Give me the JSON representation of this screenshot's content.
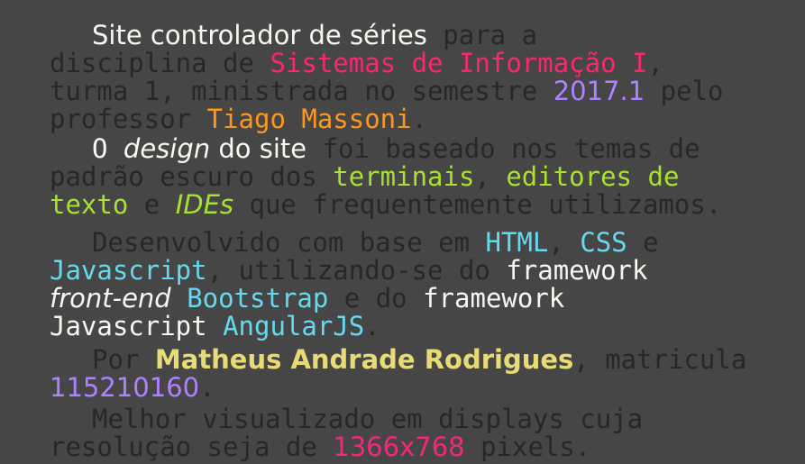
{
  "colors": {
    "background": "#464646",
    "dim_text": "#272727",
    "white": "#f8f8f2",
    "pink": "#f92672",
    "purple": "#ae81ff",
    "orange": "#fd971f",
    "green": "#a6e22e",
    "cyan": "#66d9ef",
    "yellow": "#e6db74"
  },
  "p1": {
    "site_title": "Site controlador de séries",
    "t1": " para a",
    "t2": "disciplina de ",
    "discipline": "Sistemas de Informação I",
    "t3": ",",
    "t4": "turma 1, ministrada no semestre ",
    "semester": "2017.1",
    "t5": " pelo",
    "t6": "professor ",
    "professor": "Tiago Massoni",
    "t7": "."
  },
  "p2": {
    "t1": "O ",
    "design": "design",
    "t2": " do site",
    "t3": " foi baseado nos temas de",
    "t4": "padrão escuro dos ",
    "terminals": "terminais",
    "t5": ", ",
    "editors": "editores de",
    "editors2": "texto",
    "t6": " e ",
    "ides": "IDEs",
    "t7": " que frequentemente utilizamos."
  },
  "p3": {
    "t1": "Desenvolvido com base em ",
    "html": "HTML",
    "t2": ", ",
    "css": "CSS",
    "t3": " e",
    "javascript": "Javascript",
    "t4": ", utilizando-se do ",
    "framework1": "framework",
    "frontend": "front-end",
    "t5": " ",
    "bootstrap": "Bootstrap",
    "t6": " e do ",
    "framework2": "framework",
    "javascript2": "Javascript",
    "t7": " ",
    "angular": "AngularJS",
    "t8": "."
  },
  "p4": {
    "t1": "Por ",
    "author": "Matheus Andrade Rodrigues",
    "t2": ", matricula",
    "registration": "115210160",
    "t3": "."
  },
  "p5": {
    "t1": "Melhor visualizado em displays cuja",
    "t2": "resolução seja de ",
    "resolution": "1366x768",
    "t3": " pixels."
  }
}
